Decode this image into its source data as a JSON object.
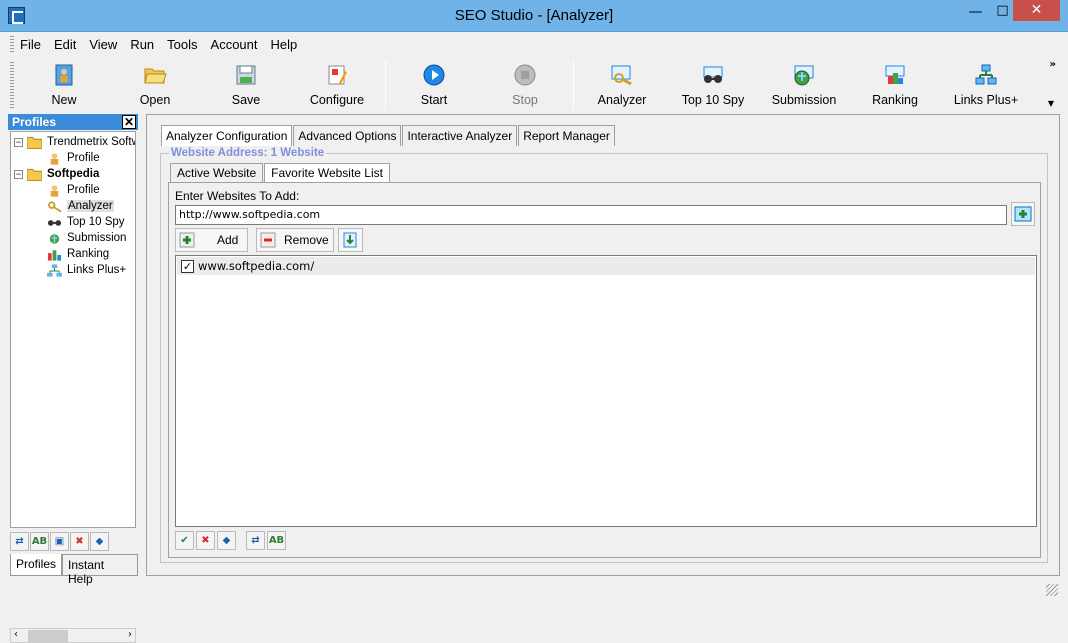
{
  "window": {
    "title": "SEO Studio - [Analyzer]"
  },
  "menu": [
    "File",
    "Edit",
    "View",
    "Run",
    "Tools",
    "Account",
    "Help"
  ],
  "toolbar": [
    {
      "label": "New",
      "icon": "new-profile-icon"
    },
    {
      "label": "Open",
      "icon": "open-folder-icon"
    },
    {
      "label": "Save",
      "icon": "save-icon"
    },
    {
      "label": "Configure",
      "icon": "configure-icon"
    },
    {
      "label": "Start",
      "icon": "start-icon"
    },
    {
      "label": "Stop",
      "icon": "stop-icon",
      "disabled": true
    },
    {
      "label": "Analyzer",
      "icon": "analyzer-icon"
    },
    {
      "label": "Top 10 Spy",
      "icon": "spy-icon"
    },
    {
      "label": "Submission",
      "icon": "submission-icon"
    },
    {
      "label": "Ranking",
      "icon": "ranking-icon"
    },
    {
      "label": "Links Plus+",
      "icon": "links-plus-icon"
    }
  ],
  "profiles_panel": {
    "title": "Profiles",
    "tree": [
      {
        "label": "Trendmetrix Softw",
        "icon": "folder-icon",
        "expanded": true
      },
      {
        "label": "Profile",
        "icon": "profile-icon"
      },
      {
        "label": "Softpedia",
        "icon": "folder-icon",
        "expanded": true
      },
      {
        "label": "Profile",
        "icon": "profile-icon"
      },
      {
        "label": "Analyzer",
        "icon": "analyzer-icon",
        "selected": true
      },
      {
        "label": "Top 10 Spy",
        "icon": "spy-icon"
      },
      {
        "label": "Submission",
        "icon": "submission-icon"
      },
      {
        "label": "Ranking",
        "icon": "ranking-icon"
      },
      {
        "label": "Links Plus+",
        "icon": "links-plus-icon"
      }
    ],
    "tabs": [
      "Profiles",
      "Instant Help"
    ]
  },
  "main": {
    "tabs": [
      "Analyzer Configuration",
      "Advanced Options",
      "Interactive Analyzer",
      "Report Manager"
    ],
    "group_title": "Website Address: 1 Website",
    "subtabs": [
      "Active Website",
      "Favorite Website List"
    ],
    "enter_label": "Enter Websites To Add:",
    "url_value": "http://www.softpedia.com",
    "add_label": "Add",
    "remove_label": "Remove",
    "websites": [
      {
        "url": "www.softpedia.com/",
        "checked": true
      }
    ]
  },
  "colors": {
    "titlebar": "#6fb3e8",
    "close": "#c7504a",
    "panel_head": "#3a8bd9",
    "group_title": "#7f8fd9"
  }
}
